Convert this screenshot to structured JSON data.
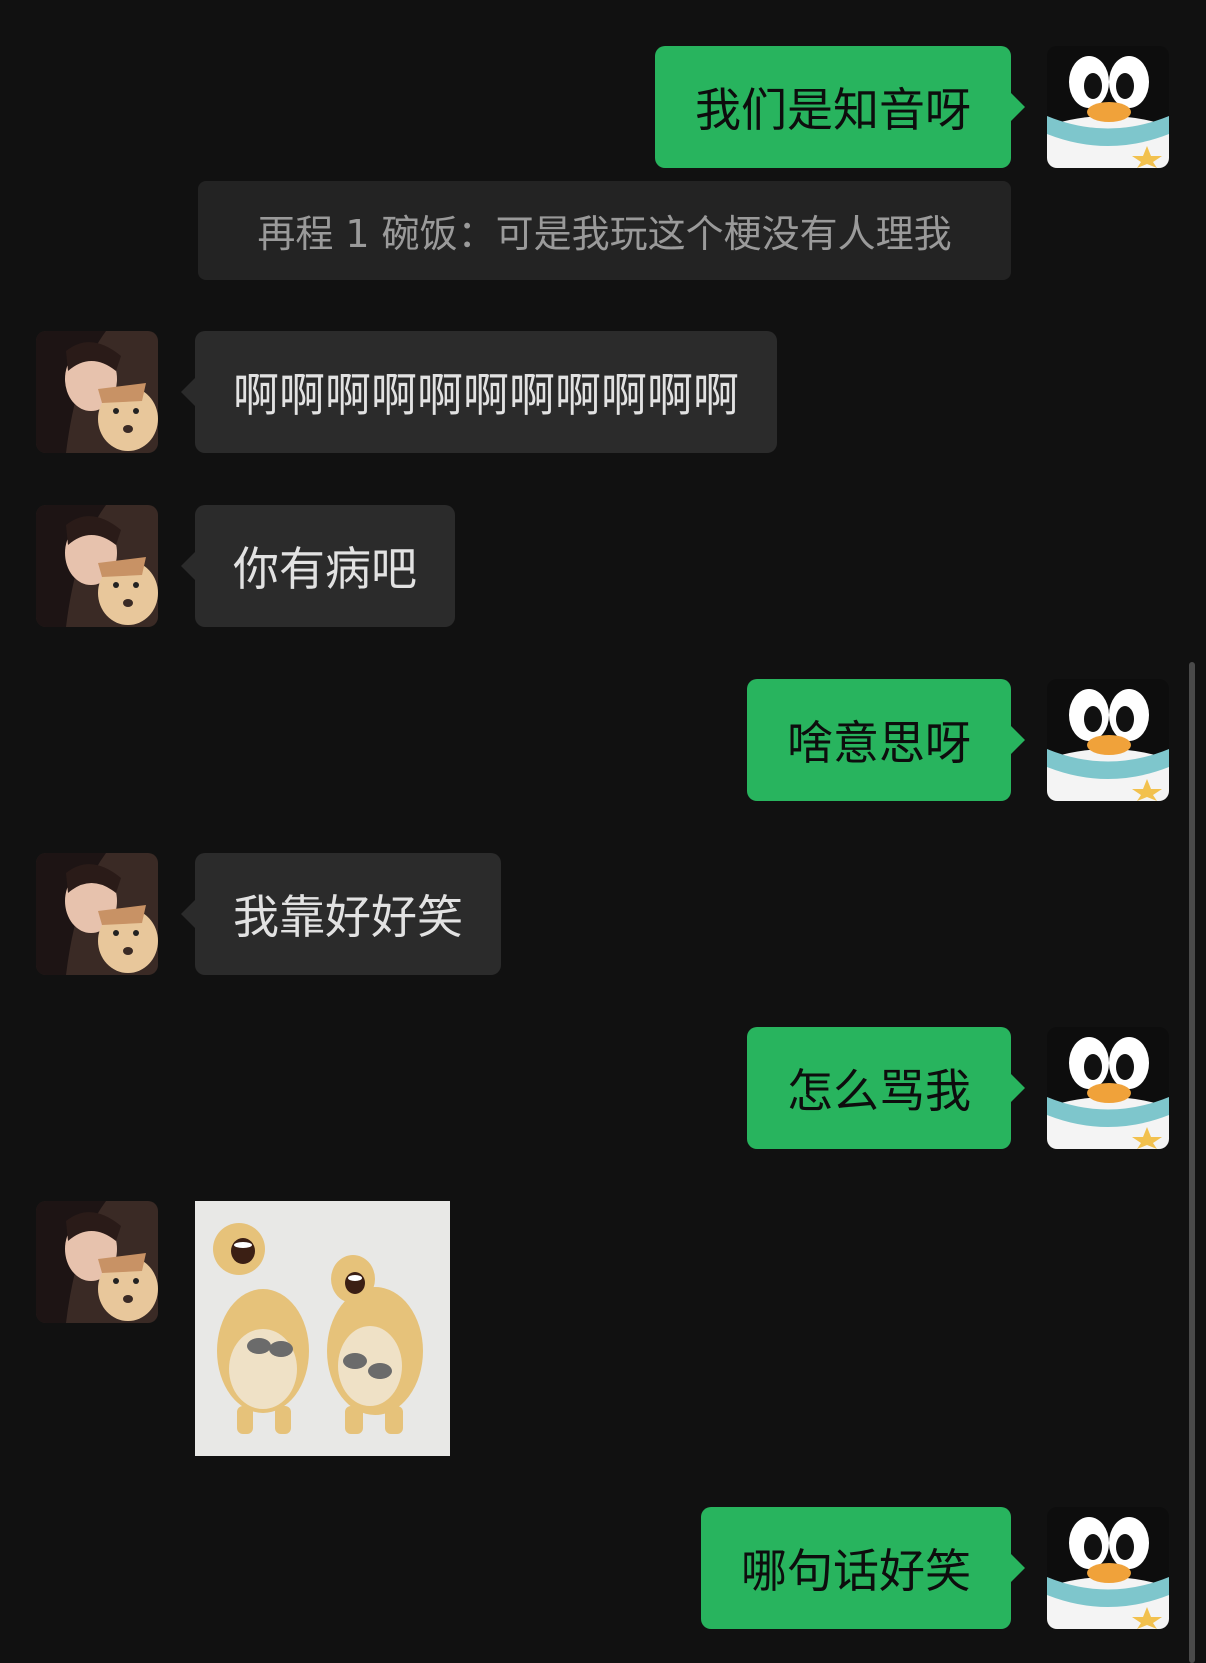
{
  "messages": {
    "m1": {
      "text": "我们是知音呀",
      "sender": "me"
    },
    "quote": {
      "text": "再程 1 碗饭：可是我玩这个梗没有人理我"
    },
    "m2": {
      "text": "啊啊啊啊啊啊啊啊啊啊啊",
      "sender": "other"
    },
    "m3": {
      "text": "你有病吧",
      "sender": "other"
    },
    "m4": {
      "text": "啥意思呀",
      "sender": "me"
    },
    "m5": {
      "text": "我靠好好笑",
      "sender": "other"
    },
    "m6": {
      "text": "怎么骂我",
      "sender": "me"
    },
    "m7": {
      "sticker": "laughing-bears-sticker",
      "sender": "other"
    },
    "m8": {
      "text": "哪句话好笑",
      "sender": "me"
    }
  },
  "colors": {
    "background": "#111111",
    "outgoing_bubble": "#28b45e",
    "incoming_bubble": "#2b2b2b",
    "quote_bubble": "#232323"
  },
  "icons": {
    "my_avatar": "penguin-avatar-icon",
    "their_avatar": "girl-with-dog-avatar"
  }
}
